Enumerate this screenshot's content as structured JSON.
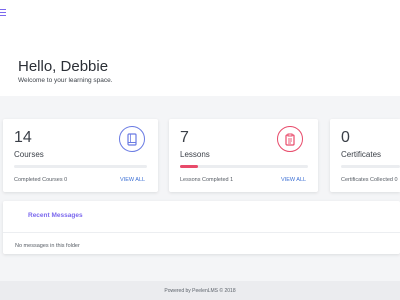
{
  "header": {
    "greeting": "Hello, Debbie",
    "subtitle": "Welcome to your learning space."
  },
  "cards": [
    {
      "count": "14",
      "label": "Courses",
      "footer_text": "Completed Courses 0",
      "link_label": "VIEW ALL",
      "progress": 0,
      "accent_color": "#6a7be3",
      "icon": "book-icon"
    },
    {
      "count": "7",
      "label": "Lessons",
      "footer_text": "Lessons Completed 1",
      "link_label": "VIEW ALL",
      "progress": 0.14,
      "accent_color": "#e84a6a",
      "icon": "clipboard-icon"
    },
    {
      "count": "0",
      "label": "Certificates",
      "footer_text": "Certificates Collected 0",
      "progress": 0
    }
  ],
  "messages": {
    "tab_label": "Recent Messages",
    "empty_text": "No messages in this folder"
  },
  "footer": {
    "text": "Powered by PeelenLMS © 2018"
  },
  "colors": {
    "accent": "#7b68ee",
    "link": "#3b6fd4",
    "background": "#f4f5f7"
  }
}
